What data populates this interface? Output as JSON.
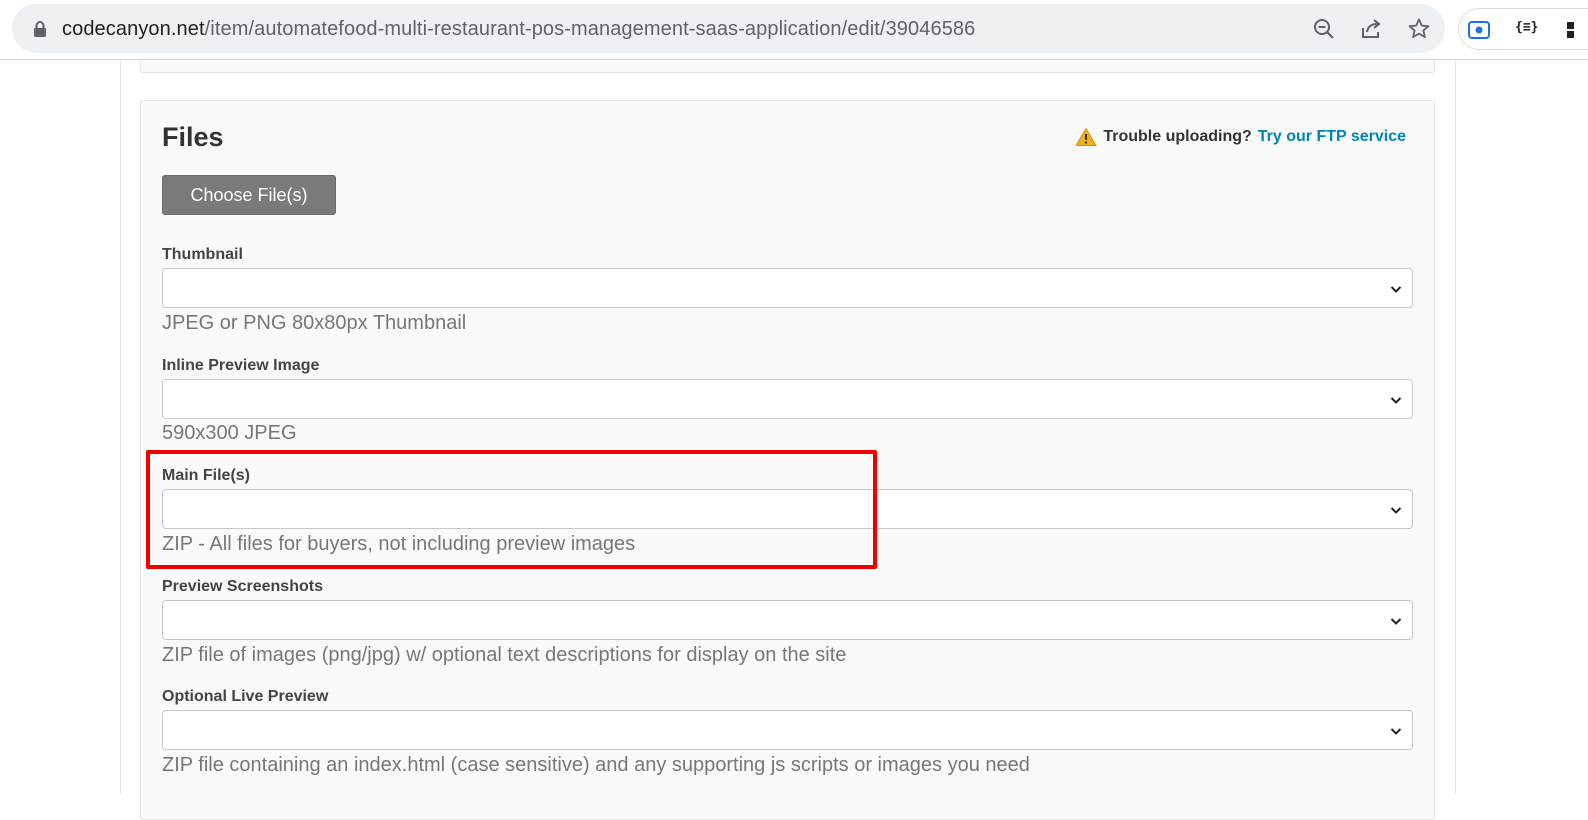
{
  "browser": {
    "url_host": "codecanyon.net",
    "url_path": "/item/automatefood-multi-restaurant-pos-management-saas-application/edit/39046586",
    "extension_text": "{≡}",
    "icons": [
      "lock-icon",
      "zoom-out-icon",
      "share-icon",
      "star-icon",
      "screen-record-icon",
      "json-extension-icon",
      "puzzle-icon"
    ]
  },
  "files_section": {
    "title": "Files",
    "trouble_text": "Trouble uploading?",
    "ftp_link": "Try our FTP service",
    "choose_button": "Choose File(s)",
    "fields": [
      {
        "label": "Thumbnail",
        "value": "",
        "hint": "JPEG or PNG 80x80px Thumbnail"
      },
      {
        "label": "Inline Preview Image",
        "value": "",
        "hint": "590x300 JPEG"
      },
      {
        "label": "Main File(s)",
        "value": "",
        "hint": "ZIP - All files for buyers, not including preview images"
      },
      {
        "label": "Preview Screenshots",
        "value": "",
        "hint": "ZIP file of images (png/jpg) w/ optional text descriptions for display on the site"
      },
      {
        "label": "Optional Live Preview",
        "value": "",
        "hint": "ZIP file containing an index.html (case sensitive) and any supporting js scripts or images you need"
      }
    ]
  },
  "colors": {
    "link": "#0084b4",
    "highlight": "#ee0000",
    "button_bg": "#7a7a7a",
    "warning": "#f0ad1c"
  }
}
